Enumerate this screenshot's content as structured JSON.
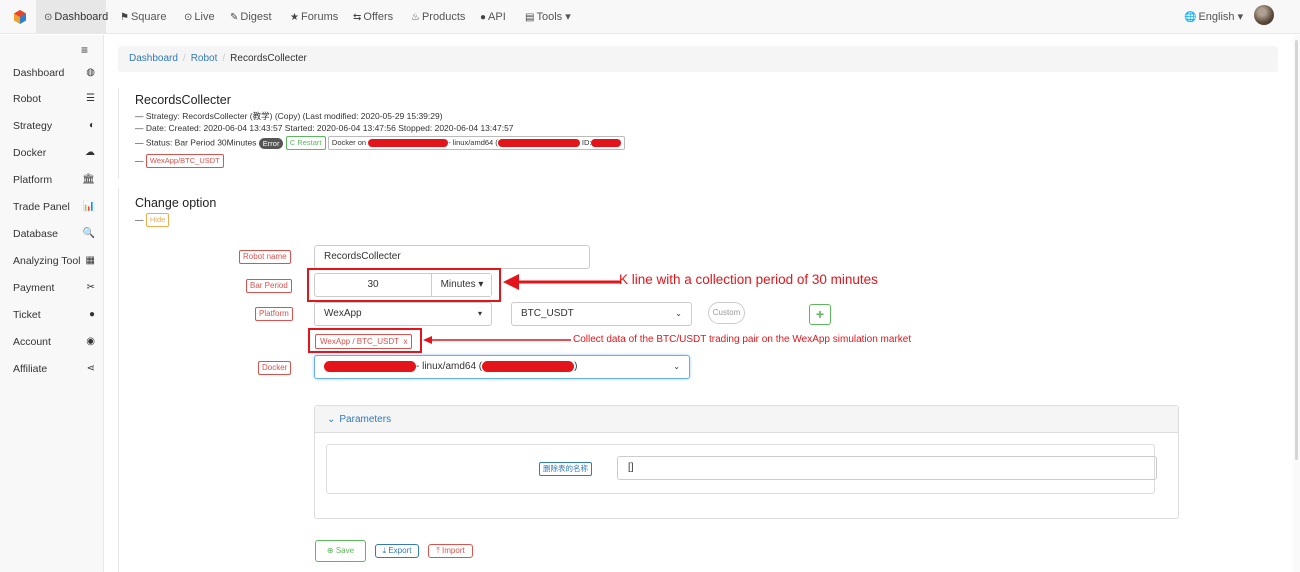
{
  "nav": {
    "items": [
      {
        "icon": "⊙",
        "label": "Dashboard"
      },
      {
        "icon": "⚑",
        "label": "Square"
      },
      {
        "icon": "⊙",
        "label": "Live"
      },
      {
        "icon": "✎",
        "label": "Digest"
      },
      {
        "icon": "★",
        "label": "Forums"
      },
      {
        "icon": "⇆",
        "label": "Offers"
      },
      {
        "icon": "♨",
        "label": "Products"
      },
      {
        "icon": "●",
        "label": "API"
      },
      {
        "icon": "▤",
        "label": "Tools ▾"
      }
    ],
    "language": "English ▾",
    "globe_icon": "🌐"
  },
  "sidebar": {
    "items": [
      {
        "label": "Dashboard",
        "icon": "◍"
      },
      {
        "label": "Robot",
        "icon": "☰"
      },
      {
        "label": "Strategy",
        "icon": "◐"
      },
      {
        "label": "Docker",
        "icon": "☁"
      },
      {
        "label": "Platform",
        "icon": "🏛"
      },
      {
        "label": "Trade Panel",
        "icon": "📊"
      },
      {
        "label": "Database",
        "icon": "🔍"
      },
      {
        "label": "Analyzing Tool",
        "icon": "▦"
      },
      {
        "label": "Payment",
        "icon": "✂"
      },
      {
        "label": "Ticket",
        "icon": "●"
      },
      {
        "label": "Account",
        "icon": "◉"
      },
      {
        "label": "Affiliate",
        "icon": "⋖"
      }
    ]
  },
  "breadcrumb": {
    "home": "Dashboard",
    "parent": "Robot",
    "current": "RecordsCollecter",
    "sep": "/"
  },
  "robot": {
    "title": "RecordsCollecter",
    "strategy_line": "— Strategy: RecordsCollecter (教学) (Copy)  (Last modified: 2020-05-29 15:39:29)",
    "date_line": "— Date: Created: 2020-06-04 13:43:57 Started: 2020-06-04 13:47:56 Stopped: 2020-06-04 13:47:57",
    "status_prefix": "— Status: Bar Period 30Minutes",
    "status_badge": "Error",
    "restart_label": "C Restart",
    "docker_prefix": "Docker on",
    "docker_mid": "- linux/amd64 (",
    "docker_id": "ID:",
    "pair_prefix": "—",
    "pair_tag": "WexApp/BTC_USDT"
  },
  "change": {
    "title": "Change option",
    "dash": "—",
    "hide_label": "Hide"
  },
  "form": {
    "robot_name_label": "Robot name",
    "robot_name_value": "RecordsCollecter",
    "bar_period_label": "Bar Period",
    "bar_period_value": "30",
    "bar_period_unit": "Minutes ▾",
    "platform_label": "Platform",
    "platform_value": "WexApp",
    "pair_value": "BTC_USDT",
    "custom_label": "Custom",
    "add_label": "+",
    "selected_pair": "WexApp / BTC_USDT",
    "remove_x": "x",
    "docker_label": "Docker",
    "docker_value": "- linux/amd64 (",
    "docker_tail": ")"
  },
  "annotations": {
    "kline": "K line with a collection period of 30 minutes",
    "collect": "Collect data of the BTC/USDT trading pair on the WexApp simulation market"
  },
  "parameters": {
    "header": "Parameters",
    "param_label": "删除表的名称",
    "param_value": "[]"
  },
  "actions": {
    "save": "Save",
    "export": "Export",
    "import": "Import"
  },
  "colors": {
    "accent": "#337ab7",
    "danger": "#d9534f",
    "annotation": "#e3141a",
    "success": "#5cb85c"
  }
}
